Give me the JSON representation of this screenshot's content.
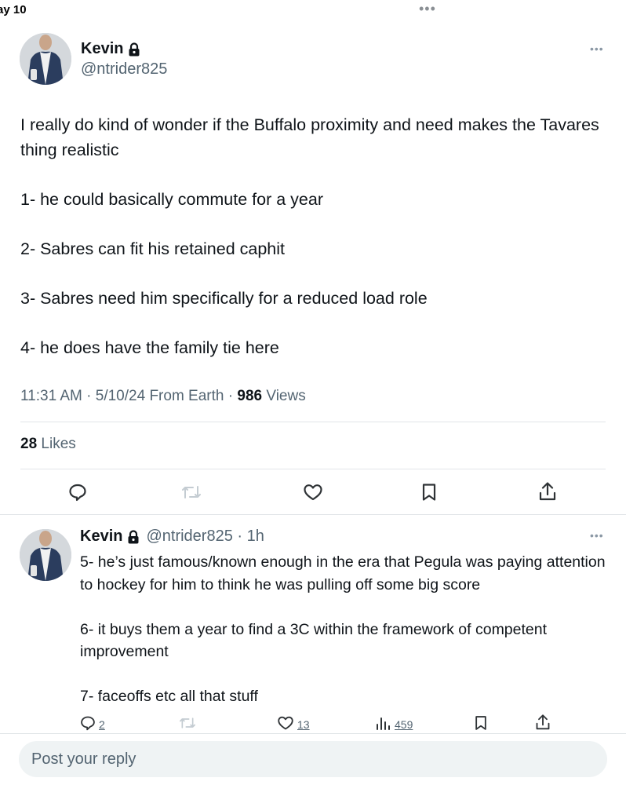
{
  "status": {
    "time": "ay 10"
  },
  "tweet": {
    "author_name": "Kevin",
    "author_handle": "@ntrider825",
    "paragraphs": [
      "I really do kind of wonder if the Buffalo proximity and need makes the Tavares thing realistic",
      "1- he could basically commute for a year",
      "2- Sabres can fit his retained caphit",
      "3- Sabres need him specifically for a reduced load role",
      "4- he does have the family tie here"
    ],
    "time": "11:31 AM",
    "date": "5/10/24",
    "source": "From Earth",
    "views_count": "986",
    "views_label": "Views",
    "likes_count": "28",
    "likes_label": "Likes"
  },
  "reply": {
    "author_name": "Kevin",
    "author_handle": "@ntrider825",
    "age": "1h",
    "paragraphs": [
      "5- he’s just famous/known enough in the era that Pegula was paying attention to hockey for him to think he was pulling off some big score",
      "6- it buys them a year to find a 3C within the framework of competent improvement",
      "7- faceoffs etc all that stuff"
    ],
    "reply_count": "2",
    "like_count": "13",
    "view_count": "459"
  },
  "composer": {
    "placeholder": "Post your reply"
  },
  "icons": [
    "lock-icon",
    "more-icon",
    "reply-icon",
    "retweet-icon",
    "like-icon",
    "bookmark-icon",
    "share-icon",
    "views-icon"
  ],
  "colors": {
    "text": "#0f1419",
    "muted": "#536471",
    "divider": "#e1e5e8",
    "input_bg": "#eff3f4"
  }
}
